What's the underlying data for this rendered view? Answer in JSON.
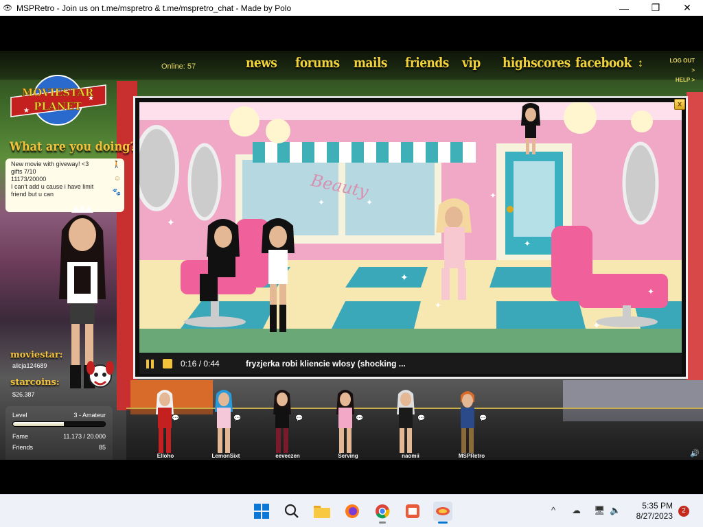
{
  "window": {
    "title": "MSPRetro - Join us on t.me/mspretro & t.me/mspretro_chat - Made by Polo",
    "minimize": "—",
    "maximize": "❐",
    "close": "✕",
    "app_icon": "👁"
  },
  "nav": {
    "online": "Online: 57",
    "items": [
      "news",
      "forums",
      "mails",
      "friends",
      "vip",
      "highscores",
      "facebook"
    ],
    "sort_icon": "↕",
    "logout": "LOG OUT >",
    "help": "HELP >"
  },
  "logo": {
    "line1": "MOVIESTAR",
    "line2": "PLANET"
  },
  "profile": {
    "heading": "What are you doing?",
    "status_lines": [
      "New movie with  giveway! <3",
      "gifts 7/10",
      "11173/20000",
      "I can't add u cause i have limit",
      "friend but u can"
    ],
    "moviestar_label": "moviestar:",
    "username": "alicja124689",
    "starcoins_label": "starcoins:",
    "starcoins": "$26.387",
    "level_label": "Level",
    "level_value": "3 - Amateur",
    "level_progress": 0.55,
    "fame_label": "Fame",
    "fame_value": "11.173 / 20.000",
    "friends_label": "Friends",
    "friends_value": "85"
  },
  "movie": {
    "time": "0:16 / 0:44",
    "title": "fryzjerka robi kliencie wlosy (shocking ...",
    "close": "x",
    "salon_sign": "Beauty"
  },
  "actors": [
    "Elloho",
    "LemonSixt",
    "eeveezen",
    "Serving",
    "naomii",
    "MSPRetro"
  ],
  "taskbar": {
    "time": "5:35 PM",
    "date": "8/27/2023",
    "notifications": "2",
    "tray_up": "^",
    "colors": {
      "accent": "#0078d4"
    }
  }
}
